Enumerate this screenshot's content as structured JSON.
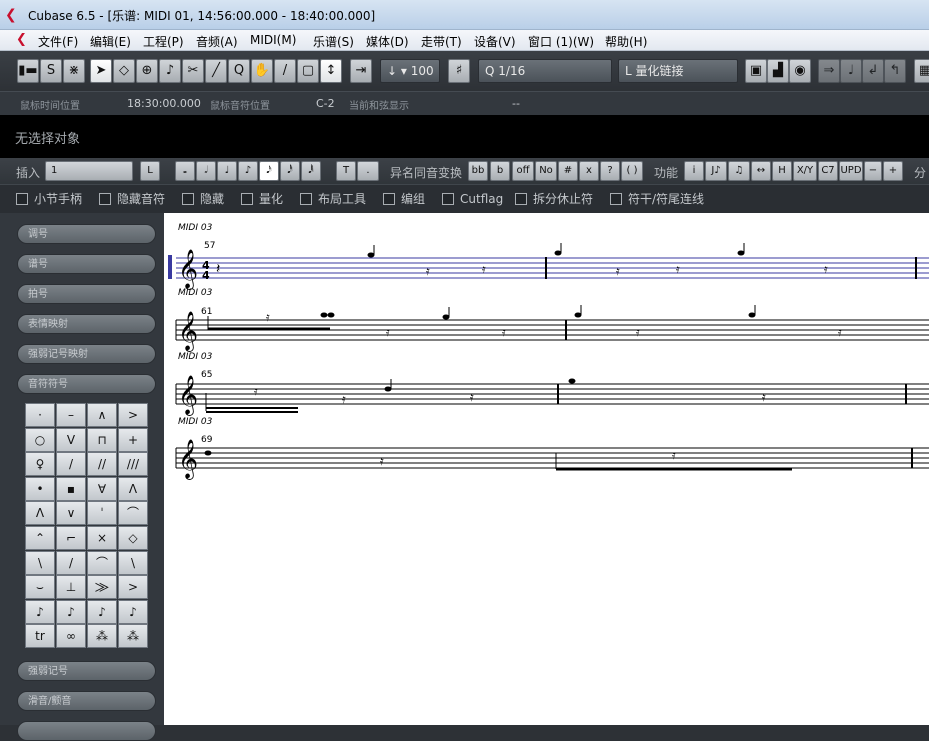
{
  "window": {
    "title": "Cubase 6.5 - [乐谱: MIDI 01, 14:56:00.000 - 18:40:00.000]"
  },
  "menu": [
    "文件(F)",
    "编辑(E)",
    "工程(P)",
    "音频(A)",
    "MIDI(M)",
    "乐谱(S)",
    "媒体(D)",
    "走带(T)",
    "设备(V)",
    "窗口 (1)(W)",
    "帮助(H)"
  ],
  "toolbar": {
    "velocity": "100",
    "quantize": "1/16",
    "quantize_link": "量化链接",
    "quantize_link_prefix": "L"
  },
  "info": {
    "mouse_time_label": "鼠标时间位置",
    "mouse_time": "18:30:00.000",
    "mouse_note_label": "鼠标音符位置",
    "mouse_note": "C-2",
    "chord_label": "当前和弦显示",
    "chord": "--"
  },
  "selection": "无选择对象",
  "toolbar2": {
    "insert_label": "插入",
    "insert_value": "1",
    "L": "L",
    "enharmonic_label": "异名同音变换",
    "function_label": "功能",
    "split_label": "分",
    "note_values": [
      "𝅝",
      "𝅗𝅥",
      "♩",
      "♪",
      "𝅘𝅥𝅯",
      "𝅘𝅥𝅰",
      "𝅘𝅥𝅱"
    ],
    "tuplet": [
      "T",
      "."
    ],
    "enh": [
      "bb",
      "b",
      "off",
      "No",
      "#",
      "x",
      "?",
      "( )"
    ],
    "func": [
      "i",
      "J♪",
      "♫",
      "↔",
      "H",
      "X/Y",
      "C7",
      "UPD",
      "−",
      "+"
    ]
  },
  "checks": [
    "小节手柄",
    "隐藏音符",
    "隐藏",
    "量化",
    "布局工具",
    "编组",
    "Cutflag",
    "拆分休止符",
    "符干/符尾连线"
  ],
  "sidebar": {
    "sections": [
      "调号",
      "谱号",
      "拍号",
      "表情映射",
      "强弱记号映射",
      "音符符号"
    ],
    "bottom": [
      "强弱记号",
      "滑音/颤音"
    ],
    "grid": [
      "·",
      "–",
      "∧",
      ">",
      "○",
      "V",
      "⊓",
      "+",
      "♀",
      "/",
      "//",
      "///",
      "•",
      "▪",
      "∀",
      "Λ",
      "Ʌ",
      "∨",
      "ˈ",
      "⌒",
      "⌃",
      "⌐",
      "×",
      "◇",
      "\\",
      "/",
      "⌒",
      "\\",
      "⌣",
      "⊥",
      "⨠",
      ">",
      "♪",
      "♪",
      "♪",
      "♪",
      "tr",
      "∞",
      "⁂",
      "⁂"
    ]
  },
  "score": {
    "track": "MIDI 03",
    "bars": [
      "57",
      "61",
      "65",
      "69"
    ]
  }
}
